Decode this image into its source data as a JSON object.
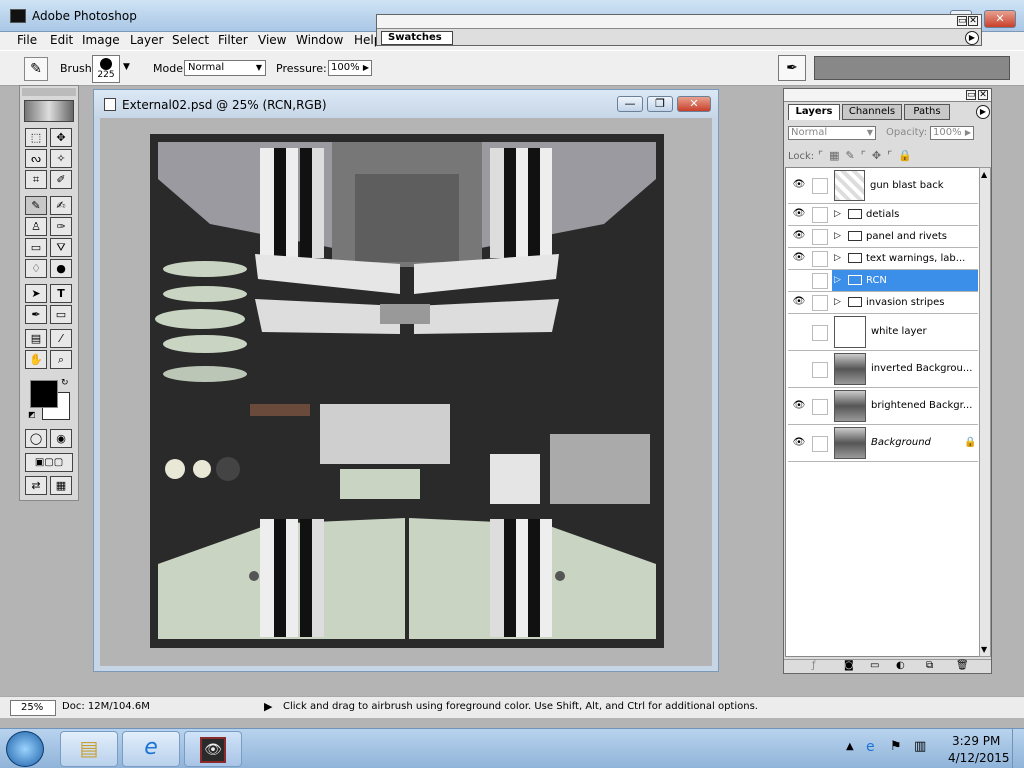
{
  "app": {
    "title": "Adobe Photoshop"
  },
  "window_buttons": {
    "minimize": "—",
    "restore": "❐",
    "close": "✕"
  },
  "menu": [
    "File",
    "Edit",
    "Image",
    "Layer",
    "Select",
    "Filter",
    "View",
    "Window",
    "Help"
  ],
  "options": {
    "brush_label": "Brush:",
    "brush_size": "225",
    "mode_label": "Mode:",
    "mode_value": "Normal",
    "pressure_label": "Pressure:",
    "pressure_value": "100%"
  },
  "swatches": {
    "tab": "Swatches"
  },
  "document": {
    "title": "External02.psd @ 25% (RCN,RGB)"
  },
  "layers_panel": {
    "tabs": [
      "Layers",
      "Channels",
      "Paths"
    ],
    "blend_mode": "Normal",
    "opacity_label": "Opacity:",
    "opacity_value": "100%",
    "lock_label": "Lock:",
    "layers": [
      {
        "name": "gun blast back",
        "visible": true,
        "type": "layer"
      },
      {
        "name": "detials",
        "visible": true,
        "type": "folder"
      },
      {
        "name": "panel and rivets",
        "visible": true,
        "type": "folder"
      },
      {
        "name": "text warnings, lab...",
        "visible": true,
        "type": "folder"
      },
      {
        "name": "RCN",
        "visible": false,
        "type": "folder",
        "selected": true
      },
      {
        "name": "invasion stripes",
        "visible": true,
        "type": "folder"
      },
      {
        "name": "white layer",
        "visible": false,
        "type": "layer"
      },
      {
        "name": "inverted Backgrou...",
        "visible": false,
        "type": "layer"
      },
      {
        "name": "brightened Backgr...",
        "visible": true,
        "type": "layer"
      },
      {
        "name": "Background",
        "visible": true,
        "type": "layer",
        "locked": true
      }
    ]
  },
  "status": {
    "zoom": "25%",
    "doc": "Doc: 12M/104.6M",
    "hint": "Click and drag to airbrush using foreground color.  Use Shift, Alt, and Ctrl for additional options."
  },
  "taskbar": {
    "time": "3:29 PM",
    "date": "4/12/2015"
  },
  "colors": {
    "selection": "#3b8fe8",
    "canvas_bg": "#2a2a2a",
    "wing_grey": "#9a9aa0",
    "wing_green": "#c9d5c2"
  }
}
